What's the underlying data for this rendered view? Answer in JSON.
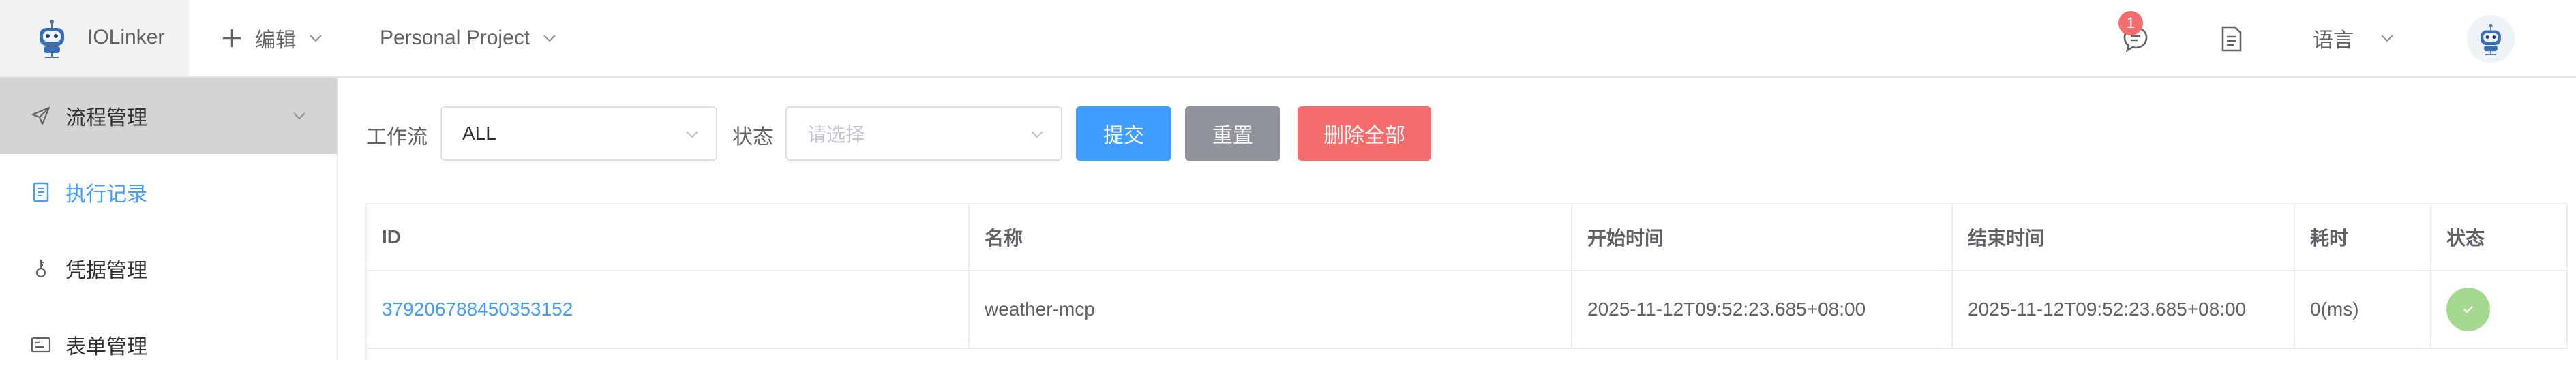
{
  "header": {
    "app_name": "IOLinker",
    "edit_label": "编辑",
    "project_label": "Personal Project",
    "notification_count": "1",
    "language_label": "语言",
    "icons": {
      "logo": "robot-logo",
      "edit": "plus-icon",
      "chevron": "chevron-down-icon",
      "messages": "chat-bubble-icon",
      "docs": "document-icon"
    }
  },
  "sidebar": {
    "items": [
      {
        "label": "流程管理",
        "icon": "send-icon",
        "group": true
      },
      {
        "label": "执行记录",
        "icon": "document-icon",
        "active": true
      },
      {
        "label": "凭据管理",
        "icon": "key-icon"
      },
      {
        "label": "表单管理",
        "icon": "form-icon"
      }
    ]
  },
  "filters": {
    "workflow_label": "工作流",
    "workflow_value": "ALL",
    "status_label": "状态",
    "status_placeholder": "请选择",
    "submit_label": "提交",
    "reset_label": "重置",
    "delete_all_label": "删除全部"
  },
  "table": {
    "columns": [
      "ID",
      "名称",
      "开始时间",
      "结束时间",
      "耗时",
      "状态"
    ],
    "rows": [
      {
        "id": "379206788450353152",
        "name": "weather-mcp",
        "start": "2025-11-12T09:52:23.685+08:00",
        "end": "2025-11-12T09:52:23.685+08:00",
        "duration": "0(ms)",
        "status": "success"
      }
    ]
  },
  "colors": {
    "primary": "#409eff",
    "info": "#909399",
    "danger": "#f56c6c",
    "success": "#a5d98f",
    "badge": "#f56c6c"
  }
}
